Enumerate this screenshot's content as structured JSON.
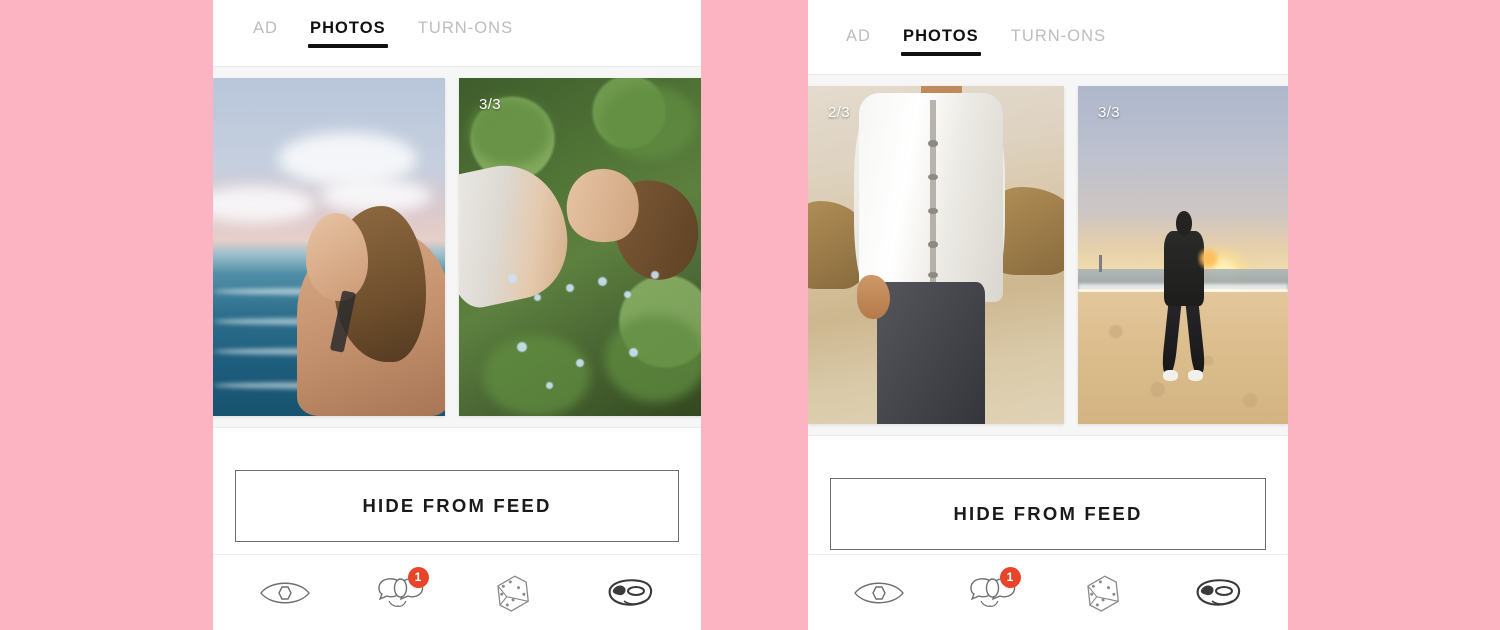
{
  "theme": {
    "page_background": "#fdb4c2",
    "panel_background": "#ffffff",
    "tab_active_color": "#111111",
    "tab_inactive_color": "#bdbdbd",
    "badge_color": "#e8442a",
    "button_border_color": "#6d6d6d"
  },
  "panels": [
    {
      "id": "left",
      "tabs": [
        {
          "label": "AD",
          "active": false
        },
        {
          "label": "PHOTOS",
          "active": true
        },
        {
          "label": "TURN-ONS",
          "active": false
        }
      ],
      "photos": [
        {
          "counter": "",
          "alt": "woman-at-beach"
        },
        {
          "counter": "3/3",
          "alt": "woman-lying-in-grass"
        }
      ],
      "hide_button_label": "HIDE FROM FEED",
      "nav": [
        {
          "icon": "eye-icon",
          "badge": ""
        },
        {
          "icon": "chat-bubbles-icon",
          "badge": "1"
        },
        {
          "icon": "dice-icon",
          "badge": ""
        },
        {
          "icon": "mask-icon",
          "badge": ""
        }
      ]
    },
    {
      "id": "right",
      "tabs": [
        {
          "label": "AD",
          "active": false
        },
        {
          "label": "PHOTOS",
          "active": true
        },
        {
          "label": "TURN-ONS",
          "active": false
        }
      ],
      "photos": [
        {
          "counter": "2/3",
          "alt": "man-in-white-shirt"
        },
        {
          "counter": "3/3",
          "alt": "man-on-beach-at-sunset"
        }
      ],
      "hide_button_label": "HIDE FROM FEED",
      "nav": [
        {
          "icon": "eye-icon",
          "badge": ""
        },
        {
          "icon": "chat-bubbles-icon",
          "badge": "1"
        },
        {
          "icon": "dice-icon",
          "badge": ""
        },
        {
          "icon": "mask-icon",
          "badge": ""
        }
      ]
    }
  ]
}
